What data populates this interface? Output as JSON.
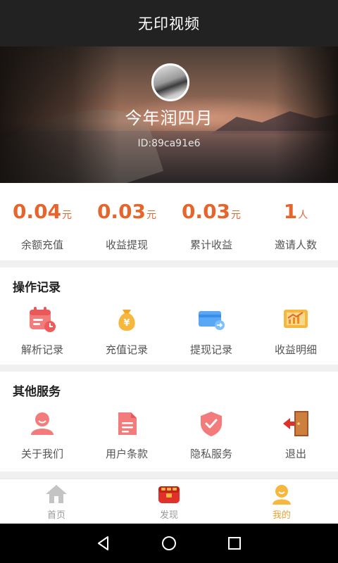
{
  "app": {
    "title": "无印视频"
  },
  "profile": {
    "nickname": "今年润四月",
    "id_text": "ID:89ca91e6"
  },
  "stats": [
    {
      "value": "0.04",
      "unit": "元",
      "label": "余额充值"
    },
    {
      "value": "0.03",
      "unit": "元",
      "label": "收益提现"
    },
    {
      "value": "0.03",
      "unit": "元",
      "label": "累计收益"
    },
    {
      "value": "1",
      "unit": "人",
      "label": "邀请人数"
    }
  ],
  "operations": {
    "title": "操作记录",
    "items": [
      {
        "label": "解析记录",
        "icon": "calendar-record-icon"
      },
      {
        "label": "充值记录",
        "icon": "money-bag-icon"
      },
      {
        "label": "提现记录",
        "icon": "card-withdraw-icon"
      },
      {
        "label": "收益明细",
        "icon": "income-chart-icon"
      }
    ]
  },
  "services": {
    "title": "其他服务",
    "items": [
      {
        "label": "关于我们",
        "icon": "person-icon"
      },
      {
        "label": "用户条款",
        "icon": "document-icon"
      },
      {
        "label": "隐私服务",
        "icon": "shield-check-icon"
      },
      {
        "label": "退出",
        "icon": "exit-door-icon"
      }
    ]
  },
  "nav": {
    "items": [
      {
        "label": "首页",
        "icon": "home-icon",
        "active": false
      },
      {
        "label": "发现",
        "icon": "treasure-chest-icon",
        "active": false
      },
      {
        "label": "我的",
        "icon": "user-icon",
        "active": true
      }
    ]
  },
  "colors": {
    "accent": "#e5662d",
    "active_nav": "#f0a030",
    "topbar": "#222222"
  },
  "system_bar": {
    "icons": [
      "back-icon",
      "home-circle-icon",
      "recents-icon"
    ]
  }
}
